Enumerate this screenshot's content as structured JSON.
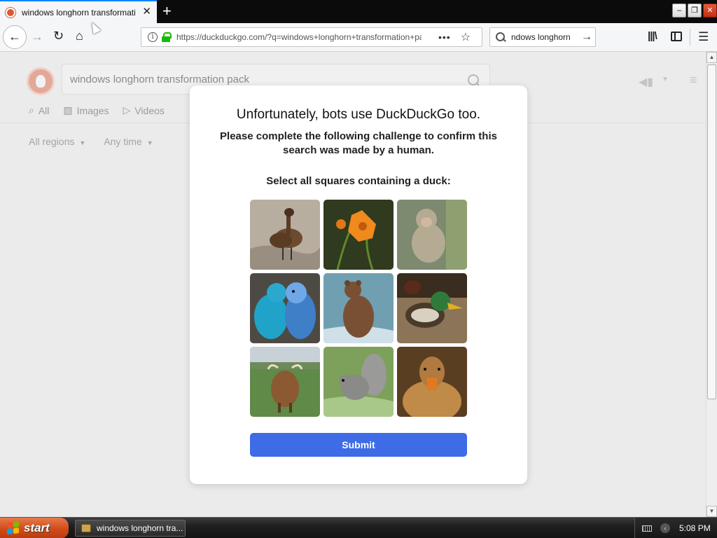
{
  "browser": {
    "tab": {
      "title": "windows longhorn transformation pack at DuckDuckGo",
      "close": "✕"
    },
    "new_tab": "+",
    "window_controls": {
      "minimize": "–",
      "restore": "❐",
      "close": "✕"
    },
    "nav": {
      "back": "←",
      "forward": "→",
      "reload": "↻",
      "home": "⌂"
    },
    "url": "https://duckduckgo.com/?q=windows+longhorn+transformation+pack",
    "url_actions": {
      "more": "•••",
      "bookmark": "☆"
    },
    "search_box": {
      "value": "ndows longhorn",
      "go": "→"
    },
    "toolbar": {
      "library": "|||\\",
      "menu": "☰"
    }
  },
  "ddg_page": {
    "search_query": "windows longhorn transformation pack",
    "tabs": [
      {
        "icon": "search-icon",
        "label": "All"
      },
      {
        "icon": "image-icon",
        "label": "Images"
      },
      {
        "icon": "play-icon",
        "label": "Videos"
      }
    ],
    "filters": [
      {
        "label": "All regions"
      },
      {
        "label": "Any time"
      }
    ]
  },
  "challenge": {
    "title": "Unfortunately, bots use DuckDuckGo too.",
    "subtitle": "Please complete the following challenge to confirm this search was made by a human.",
    "instruction": "Select all squares containing a duck:",
    "tiles": [
      {
        "subject": "duck",
        "colors": {
          "bg": "#b8aea0",
          "main": "#6b4a2e"
        }
      },
      {
        "subject": "flower",
        "colors": {
          "bg": "#2f3a1e",
          "main": "#f08a1c"
        }
      },
      {
        "subject": "monkey",
        "colors": {
          "bg": "#7d8a70",
          "main": "#b5aa92"
        }
      },
      {
        "subject": "parakeets",
        "colors": {
          "bg": "#4d4a44",
          "main": "#3f7fc8"
        }
      },
      {
        "subject": "bear",
        "colors": {
          "bg": "#6f9fb0",
          "main": "#7a5034"
        }
      },
      {
        "subject": "mallard",
        "colors": {
          "bg": "#8c7458",
          "main": "#2f7a3a"
        }
      },
      {
        "subject": "highland-cow",
        "colors": {
          "bg": "#5f8a48",
          "main": "#8b5a32"
        }
      },
      {
        "subject": "squirrel",
        "colors": {
          "bg": "#7da05a",
          "main": "#8a8a88"
        }
      },
      {
        "subject": "duck",
        "colors": {
          "bg": "#5a3e22",
          "main": "#c08a48"
        }
      }
    ],
    "submit_label": "Submit",
    "submit_color": "#3e6be6"
  },
  "taskbar": {
    "start_label": "start",
    "task_label": "windows longhorn tra...",
    "tray_expand": "‹",
    "clock": "5:08 PM"
  }
}
